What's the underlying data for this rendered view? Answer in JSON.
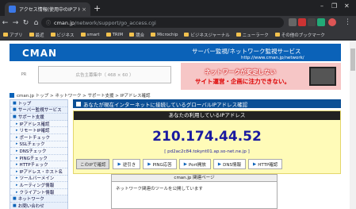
{
  "browser": {
    "tab_title": "アクセス情報(使用中のIPアドレス確...",
    "tab_close": "×",
    "new_tab": "+",
    "window_controls": [
      "–",
      "❐",
      "✕"
    ],
    "url_host": "cman.jp",
    "url_path": "/network/support/go_access.cgi",
    "bookmarks": [
      "アプリ",
      "最近",
      "ビジネス",
      "smart",
      "TRIM",
      "競合",
      "Microchip",
      "ビジネスジャーナル",
      "ニューラーク",
      "その他のブックマーク"
    ]
  },
  "header": {
    "logo": "CMAN",
    "title": "サーバー監視/ネットワーク監視サービス",
    "url": "http://www.cman.jp/network/"
  },
  "ad": {
    "pr_label": "PR",
    "placeholder": "広告主募集中（ 468 × 60 ）",
    "banner_line1": "ネットワークが安定しない",
    "banner_line2": "サイト運営・企画に注力できない。"
  },
  "breadcrumb": "cman.jp トップ > ネットワーク > サポート支援 > IPアドレス確認",
  "sidebar": {
    "items": [
      {
        "label": "トップ",
        "sub": false
      },
      {
        "label": "サーバー監視サービス",
        "sub": false
      },
      {
        "label": "サポート支援",
        "sub": false
      },
      {
        "label": "IPアドレス確認",
        "sub": true
      },
      {
        "label": "リモートIP確認",
        "sub": true
      },
      {
        "label": "ポートチェック",
        "sub": true
      },
      {
        "label": "SSLチェック",
        "sub": true
      },
      {
        "label": "DNSチェック",
        "sub": true
      },
      {
        "label": "PINGチェック",
        "sub": true
      },
      {
        "label": "HTTPチェック",
        "sub": true
      },
      {
        "label": "IPアドレス・ホスト名",
        "sub": true
      },
      {
        "label": "ツールバーメイン",
        "sub": true
      },
      {
        "label": "ルーティング情報",
        "sub": true
      },
      {
        "label": "クライアント情報",
        "sub": true
      },
      {
        "label": "ネットワーク",
        "sub": false
      },
      {
        "label": "お問い合わせ",
        "sub": false
      }
    ]
  },
  "main": {
    "section_title": "あなたが現在インターネットに接続しているグローバルIPアドレス確認",
    "panel_head": "あなたの利用しているIPアドレス",
    "ip_address": "210.174.44.52",
    "hostname": "[ pd2ac2c84.tokynt01.ap.so-net.ne.jp ]",
    "quick_label": "このIPで確認",
    "quick_buttons": [
      "逆引き",
      "PING応答",
      "Port開放",
      "DNS情報",
      "HTTP確認"
    ]
  },
  "related": {
    "head": "cman.jp 関連ページ",
    "text": "ネットワーク関連のツールを公開しています"
  },
  "colors": {
    "brand_blue": "#0b62b8",
    "ip_text": "#1a1aa0",
    "panel_bg": "#fffbb8"
  }
}
